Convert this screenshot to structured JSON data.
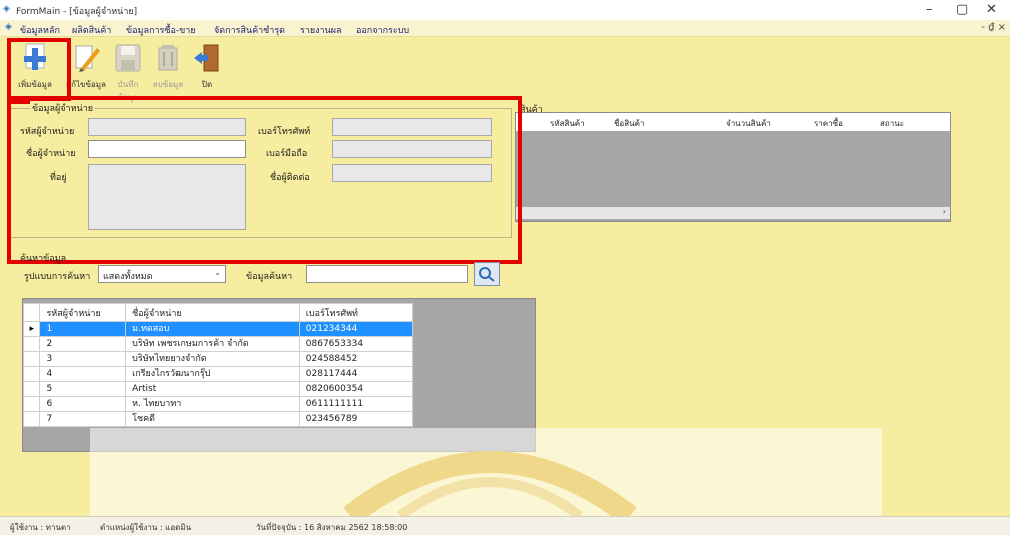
{
  "window": {
    "title": "FormMain - [ข้อมูลผู้จำหน่าย]",
    "controls": [
      "–",
      "▢",
      "✕"
    ],
    "mdi_controls": "- ₫ ×"
  },
  "menu": [
    "ข้อมูลหลัก",
    "ผลิตสินค้า",
    "ข้อมูลการซื้อ-ขาย",
    "จัดการสินค้าชำรุด",
    "รายงานผล",
    "ออกจากระบบ"
  ],
  "toolbar": {
    "add": "เพิ่มข้อมูล",
    "edit": "แก้ไขข้อมูล",
    "save": "บันทึกข้อมูล",
    "delete": "ลบข้อมูล",
    "exit": "ปิด"
  },
  "supplier_form": {
    "group_title": "ข้อมูลผู้จำหน่าย",
    "id_label": "รหัสผู้จำหน่าย",
    "name_label": "ชื่อผู้จำหน่าย",
    "address_label": "ที่อยู่",
    "phone_label": "เบอร์โทรศัพท์",
    "mobile_label": "เบอร์มือถือ",
    "contact_label": "ชื่อผู้ติดต่อ",
    "id_value": "",
    "name_value": "",
    "address_value": "",
    "phone_value": "",
    "mobile_value": "",
    "contact_value": ""
  },
  "product_panel": {
    "title": "สินค้า",
    "columns": [
      "รหัสสินค้า",
      "ชื่อสินค้า",
      "จำนวนสินค้า",
      "ราคาซื้อ",
      "สถานะ"
    ]
  },
  "search": {
    "group_title": "ค้นหาข้อมูล",
    "type_label": "รูปแบบการค้นหา",
    "type_value": "แสดงทั้งหมด",
    "keyword_label": "ข้อมูลค้นหา",
    "keyword_value": ""
  },
  "supplier_table": {
    "columns": [
      "รหัสผู้จำหน่าย",
      "ชื่อผู้จำหน่าย",
      "เบอร์โทรศัพท์"
    ],
    "rows": [
      {
        "id": "1",
        "name": "ม.ทดสอบ",
        "phone": "021234344"
      },
      {
        "id": "2",
        "name": "บริษัท เพชรเกษมการค้า จำกัด",
        "phone": "0867653334"
      },
      {
        "id": "3",
        "name": "บริษัทไทยยางจำกัด",
        "phone": "024588452"
      },
      {
        "id": "4",
        "name": "เกรียงไกรวัฒนากรุ๊ป",
        "phone": "028117444"
      },
      {
        "id": "5",
        "name": "Artist",
        "phone": "0820600354"
      },
      {
        "id": "6",
        "name": "ห. ไทยบาทา",
        "phone": "0611111111"
      },
      {
        "id": "7",
        "name": "โชคดี",
        "phone": "023456789"
      }
    ],
    "selected_index": 0
  },
  "status": {
    "user": "ผู้ใช้งาน : ทานตา",
    "position": "ตำแหน่งผู้ใช้งาน : แอดมิน",
    "date": "วันที่ปัจจุบัน : 16 สิงหาคม 2562 18:58:00"
  },
  "colors": {
    "background": "#f7eda0",
    "highlight": "#e30000",
    "selection": "#1e90ff"
  }
}
